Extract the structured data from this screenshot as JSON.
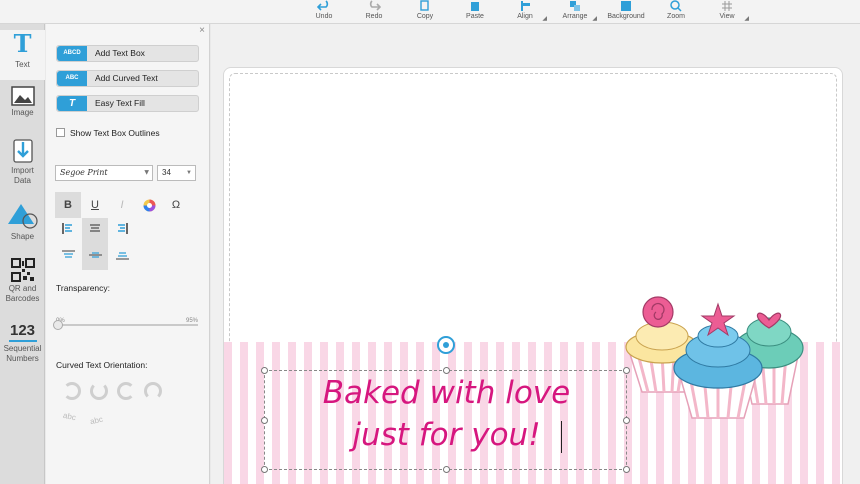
{
  "toolbar": {
    "items": [
      {
        "label": "Undo",
        "icon": "undo-icon"
      },
      {
        "label": "Redo",
        "icon": "redo-icon"
      },
      {
        "label": "Copy",
        "icon": "copy-icon"
      },
      {
        "label": "Paste",
        "icon": "paste-icon"
      },
      {
        "label": "Align",
        "icon": "align-icon"
      },
      {
        "label": "Arrange",
        "icon": "arrange-icon"
      },
      {
        "label": "Background",
        "icon": "background-icon"
      },
      {
        "label": "Zoom",
        "icon": "zoom-icon"
      },
      {
        "label": "View",
        "icon": "view-icon"
      }
    ]
  },
  "rail": {
    "items": [
      {
        "label": "Text",
        "icon": "text-icon"
      },
      {
        "label": "Image",
        "icon": "image-icon"
      },
      {
        "label_line1": "Import",
        "label_line2": "Data",
        "icon": "import-icon"
      },
      {
        "label": "Shape",
        "icon": "shape-icon"
      },
      {
        "label_line1": "QR and",
        "label_line2": "Barcodes",
        "icon": "qr-icon"
      },
      {
        "glyph": "123",
        "label_line1": "Sequential",
        "label_line2": "Numbers",
        "icon": "sequential-numbers-icon"
      }
    ]
  },
  "panel": {
    "close": "×",
    "buttons": [
      {
        "badge": "ABCD",
        "label": "Add Text Box"
      },
      {
        "badge": "ABC",
        "label": "Add Curved Text"
      },
      {
        "badge": "T",
        "label": "Easy Text Fill"
      }
    ],
    "outline_label": "Show Text Box Outlines",
    "font_family": "Segoe Print",
    "font_size": "34",
    "format": {
      "bold": "B",
      "underline": "U",
      "italic": "I",
      "omega": "Ω"
    },
    "transparency_label": "Transparency:",
    "slider_min": "0%",
    "slider_max": "95%",
    "transparency_value": 0,
    "curved_label": "Curved Text Orientation:",
    "curve_sample_1": "abc",
    "curve_sample_2": "abc"
  },
  "canvas": {
    "line1": "Baked with love",
    "line2": "just for you!"
  },
  "colors": {
    "accent": "#2f9fd8",
    "text_pink": "#d6177f",
    "stripe_pink": "#f9d7e6"
  }
}
